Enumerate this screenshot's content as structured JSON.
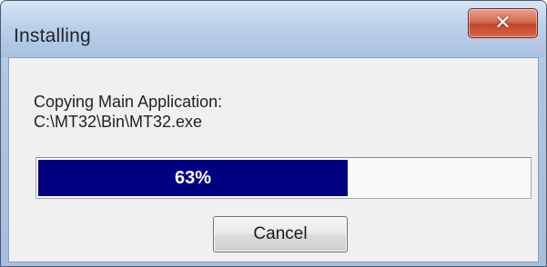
{
  "window": {
    "title": "Installing",
    "close_glyph": "✕",
    "close_icon": "close-icon"
  },
  "message": {
    "line1": "Copying Main Application:",
    "line2": "C:\\MT32\\Bin\\MT32.exe"
  },
  "progress": {
    "value": 0.63,
    "label": "63%",
    "fill_color": "#000080"
  },
  "buttons": {
    "cancel_label": "Cancel"
  }
}
